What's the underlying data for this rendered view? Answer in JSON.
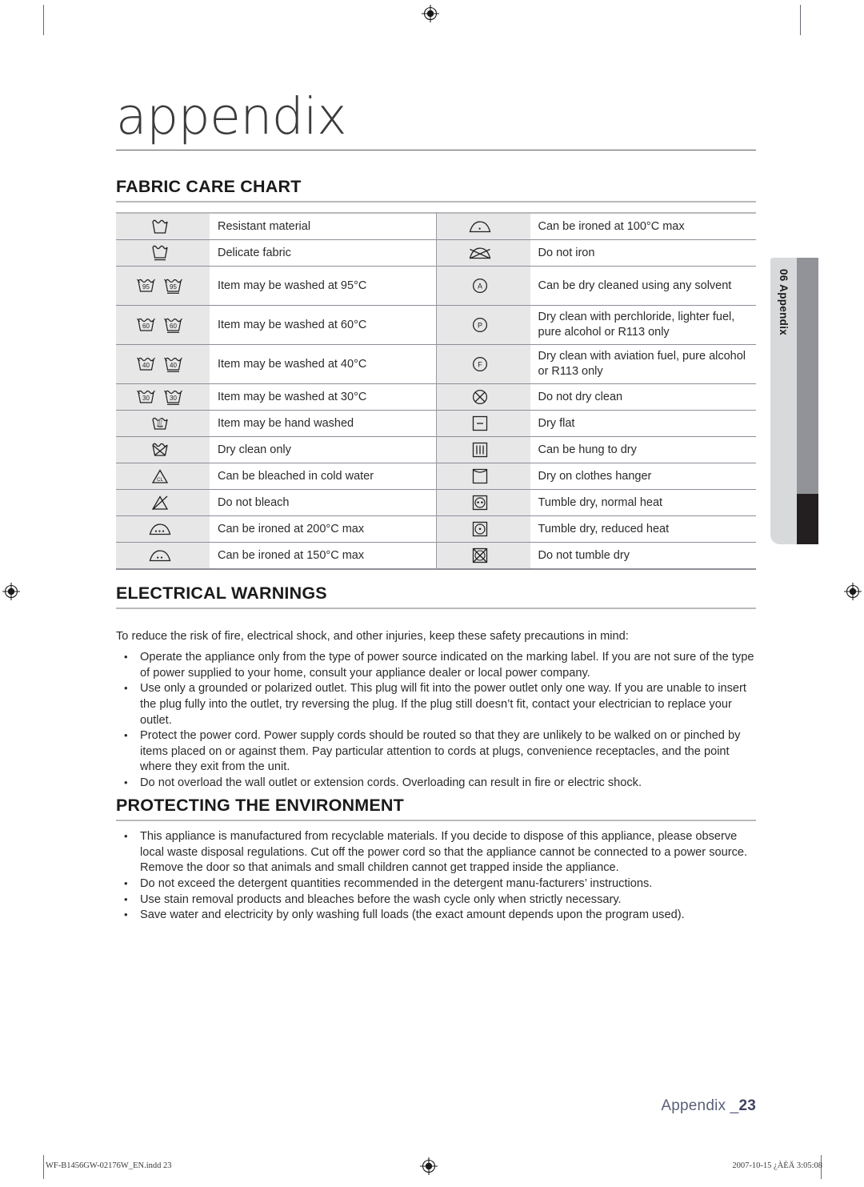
{
  "chapter": {
    "title": "appendix"
  },
  "side_tab": {
    "label": "06 Appendix"
  },
  "sections": {
    "fabric_care": {
      "heading": "FABRIC CARE CHART"
    },
    "electrical": {
      "heading": "ELECTRICAL WARNINGS",
      "lead": "To reduce the risk of fire, electrical shock, and other injuries, keep these safety precautions in mind:",
      "bullets": [
        "Operate the appliance only from the type of power source indicated on the marking label. If you are not sure of the type of power supplied to your home, consult your appliance dealer or local power company.",
        "Use only a grounded or polarized outlet. This plug will fit into the power outlet only one way. If you are unable to insert the plug fully into the outlet, try reversing the plug. If the plug still doesn’t fit, contact your electrician to replace your outlet.",
        "Protect the power cord. Power supply cords should be routed so that they are unlikely to be walked on or pinched by items placed on or against them. Pay particular attention to cords at plugs, convenience receptacles, and the point where they exit from the unit.",
        "Do not overload the wall outlet or extension cords. Overloading can result in fire or electric shock."
      ]
    },
    "environment": {
      "heading": "PROTECTING THE ENVIRONMENT",
      "bullets": [
        "This appliance is manufactured from recyclable materials. If you decide to dispose of this appliance, please observe local waste disposal regulations. Cut off the power cord so that the appliance cannot be connected to a power source. Remove the door so that animals and small children cannot get trapped inside the appliance.",
        "Do not exceed the detergent quantities recommended in the detergent manu-facturers’ instructions.",
        "Use stain removal products and bleaches before the wash cycle only when strictly necessary.",
        "Save water and electricity by only washing full loads (the exact amount depends upon the program used)."
      ]
    }
  },
  "care_chart": {
    "left_rows": [
      {
        "icon": "wash-tub",
        "label": "Resistant material"
      },
      {
        "icon": "wash-tub-delicate",
        "label": "Delicate fabric"
      },
      {
        "icon": "wash-tub-95-pair",
        "label": "Item may be washed at 95°C",
        "temp": "95"
      },
      {
        "icon": "wash-tub-60-pair",
        "label": "Item may be washed at 60°C",
        "temp": "60"
      },
      {
        "icon": "wash-tub-40-pair",
        "label": "Item may be washed at 40°C",
        "temp": "40"
      },
      {
        "icon": "wash-tub-30-pair",
        "label": "Item may be washed at 30°C",
        "temp": "30"
      },
      {
        "icon": "hand-wash",
        "label": "Item may be hand washed"
      },
      {
        "icon": "dry-clean-only",
        "label": "Dry clean only"
      },
      {
        "icon": "bleach-cold",
        "label": "Can be bleached in cold water"
      },
      {
        "icon": "do-not-bleach",
        "label": "Do not bleach"
      },
      {
        "icon": "iron-three-dot",
        "label": "Can be ironed at 200°C max"
      },
      {
        "icon": "iron-two-dot",
        "label": "Can be ironed at 150°C max"
      }
    ],
    "right_rows": [
      {
        "icon": "iron-one-dot",
        "label": "Can be ironed at 100°C max"
      },
      {
        "icon": "do-not-iron",
        "label": "Do not iron"
      },
      {
        "icon": "dry-clean-a",
        "label": "Can be dry cleaned using any solvent",
        "letter": "A"
      },
      {
        "icon": "dry-clean-p",
        "label": "Dry clean with perchloride, lighter fuel, pure alcohol or R113 only",
        "letter": "P"
      },
      {
        "icon": "dry-clean-f",
        "label": "Dry clean with aviation fuel, pure alcohol or R113 only",
        "letter": "F"
      },
      {
        "icon": "do-not-dry-clean",
        "label": "Do not dry clean"
      },
      {
        "icon": "dry-flat",
        "label": "Dry flat"
      },
      {
        "icon": "hang-to-dry",
        "label": "Can be hung to dry"
      },
      {
        "icon": "drip-dry-hanger",
        "label": "Dry on clothes hanger"
      },
      {
        "icon": "tumble-dry-normal",
        "label": "Tumble dry, normal heat"
      },
      {
        "icon": "tumble-dry-reduced",
        "label": "Tumble dry, reduced heat"
      },
      {
        "icon": "do-not-tumble-dry",
        "label": "Do not tumble dry"
      }
    ]
  },
  "folio": {
    "prefix": "Appendix _",
    "page": "23"
  },
  "print_footer": {
    "file": "WF-B1456GW-02176W_EN.indd   23",
    "timestamp": "2007-10-15   ¿ÀÈÄ 3:05:08"
  },
  "colors": {
    "icon_cell_bg": "#e7e7e8",
    "rule": "#b9b9bd",
    "tab_light": "#d8d9db",
    "tab_mid": "#919398",
    "tab_dark": "#231f20",
    "folio": "#5b5f7a"
  }
}
